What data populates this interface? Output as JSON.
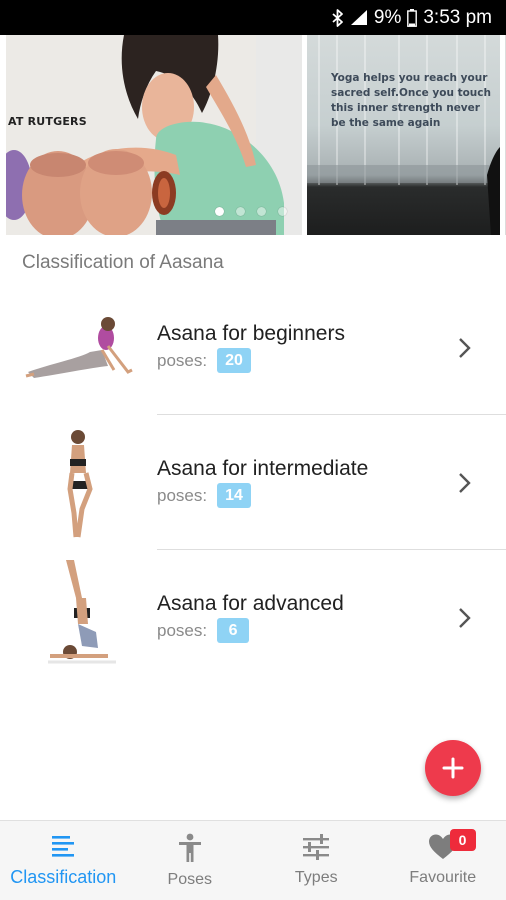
{
  "status_bar": {
    "battery": "9%",
    "time": "3:53 pm",
    "icons": [
      "bluetooth-icon",
      "signal-icon",
      "battery-icon"
    ]
  },
  "banner": {
    "slides": [
      {
        "caption": "AT RUTGERS"
      },
      {
        "caption": "Yoga helps you reach your sacred self.Once you touch this inner strength never be the same again"
      }
    ],
    "active_index": 0,
    "dot_count": 4
  },
  "section": {
    "title": "Classification of Aasana"
  },
  "classifications": [
    {
      "title": "Asana for beginners",
      "poses_label": "poses:",
      "count": "20",
      "icon": "chevron-right-icon"
    },
    {
      "title": "Asana for intermediate",
      "poses_label": "poses:",
      "count": "14",
      "icon": "chevron-right-icon"
    },
    {
      "title": "Asana for advanced",
      "poses_label": "poses:",
      "count": "6",
      "icon": "chevron-right-icon"
    }
  ],
  "fab": {
    "icon": "plus-icon"
  },
  "bottom_nav": {
    "items": [
      {
        "label": "Classification",
        "icon": "list-icon",
        "active": true
      },
      {
        "label": "Poses",
        "icon": "person-icon",
        "active": false
      },
      {
        "label": "Types",
        "icon": "sliders-icon",
        "active": false
      },
      {
        "label": "Favourite",
        "icon": "heart-icon",
        "active": false,
        "badge": "0"
      }
    ]
  },
  "colors": {
    "accent_blue": "#2196f3",
    "count_badge": "#8fd3f5",
    "fab": "#ee3a4c",
    "notification_badge": "#ee2b3b"
  }
}
